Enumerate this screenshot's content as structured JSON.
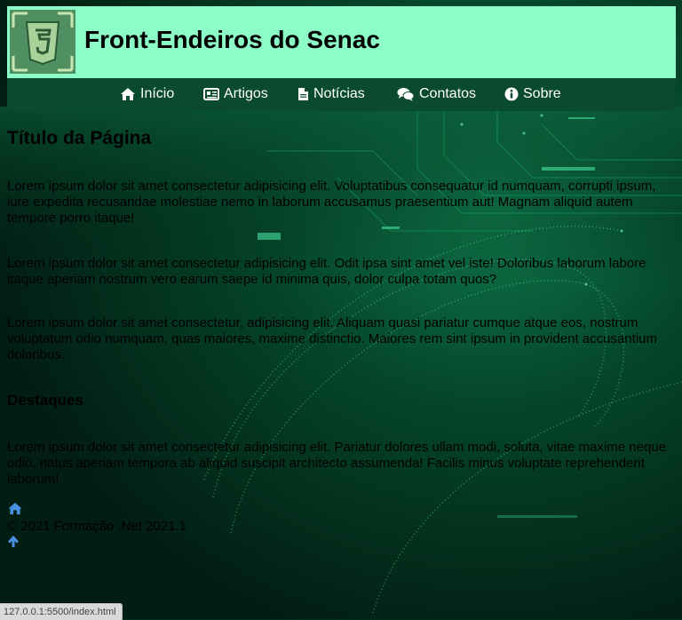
{
  "header": {
    "site_title": "Front-Endeiros do Senac",
    "logo_icon": "html5-shield-icon"
  },
  "nav": {
    "items": [
      {
        "label": "Início",
        "icon": "home-icon"
      },
      {
        "label": "Artigos",
        "icon": "newspaper-icon"
      },
      {
        "label": "Notícias",
        "icon": "document-icon"
      },
      {
        "label": "Contatos",
        "icon": "chat-bubbles-icon"
      },
      {
        "label": "Sobre",
        "icon": "info-icon"
      }
    ]
  },
  "main": {
    "page_title": "Título da Página",
    "paragraphs": [
      "Lorem ipsum dolor sit amet consectetur adipisicing elit. Voluptatibus consequatur id numquam, corrupti ipsum, iure expedita recusandae molestiae nemo in laborum accusamus praesentium aut! Magnam aliquid autem tempore porro itaque!",
      "Lorem ipsum dolor sit amet consectetur adipisicing elit. Odit ipsa sint amet vel iste! Doloribus laborum labore itaque aperiam nostrum vero earum saepe id minima quis, dolor culpa totam quos?",
      "Lorem ipsum dolor sit amet consectetur, adipisicing elit. Aliquam quasi pariatur cumque atque eos, nostrum voluptatum odio numquam, quas maiores, maxime distinctio. Maiores rem sint ipsum in provident accusantium doloribus."
    ],
    "section_title": "Destaques",
    "highlight_paragraph": "Lorem ipsum dolor sit amet consectetur adipisicing elit. Pariatur dolores ullam modi, soluta, vitae maxime neque odio, natus aperiam tempora ab aliquid suscipit architecto assumenda! Facilis minus voluptate reprehenderit laborum!"
  },
  "footer": {
    "copyright": "© 2021 Formação .Net 2021.1",
    "home_icon": "home-icon",
    "back_to_top_icon": "arrow-up-icon"
  },
  "status_bar": {
    "url": "127.0.0.1:5500/index.html"
  },
  "colors": {
    "header_bg": "#8cfdc6",
    "nav_bg": "#0a4a2e",
    "page_bg": "#03301f",
    "link_icon": "#4a90e2"
  }
}
